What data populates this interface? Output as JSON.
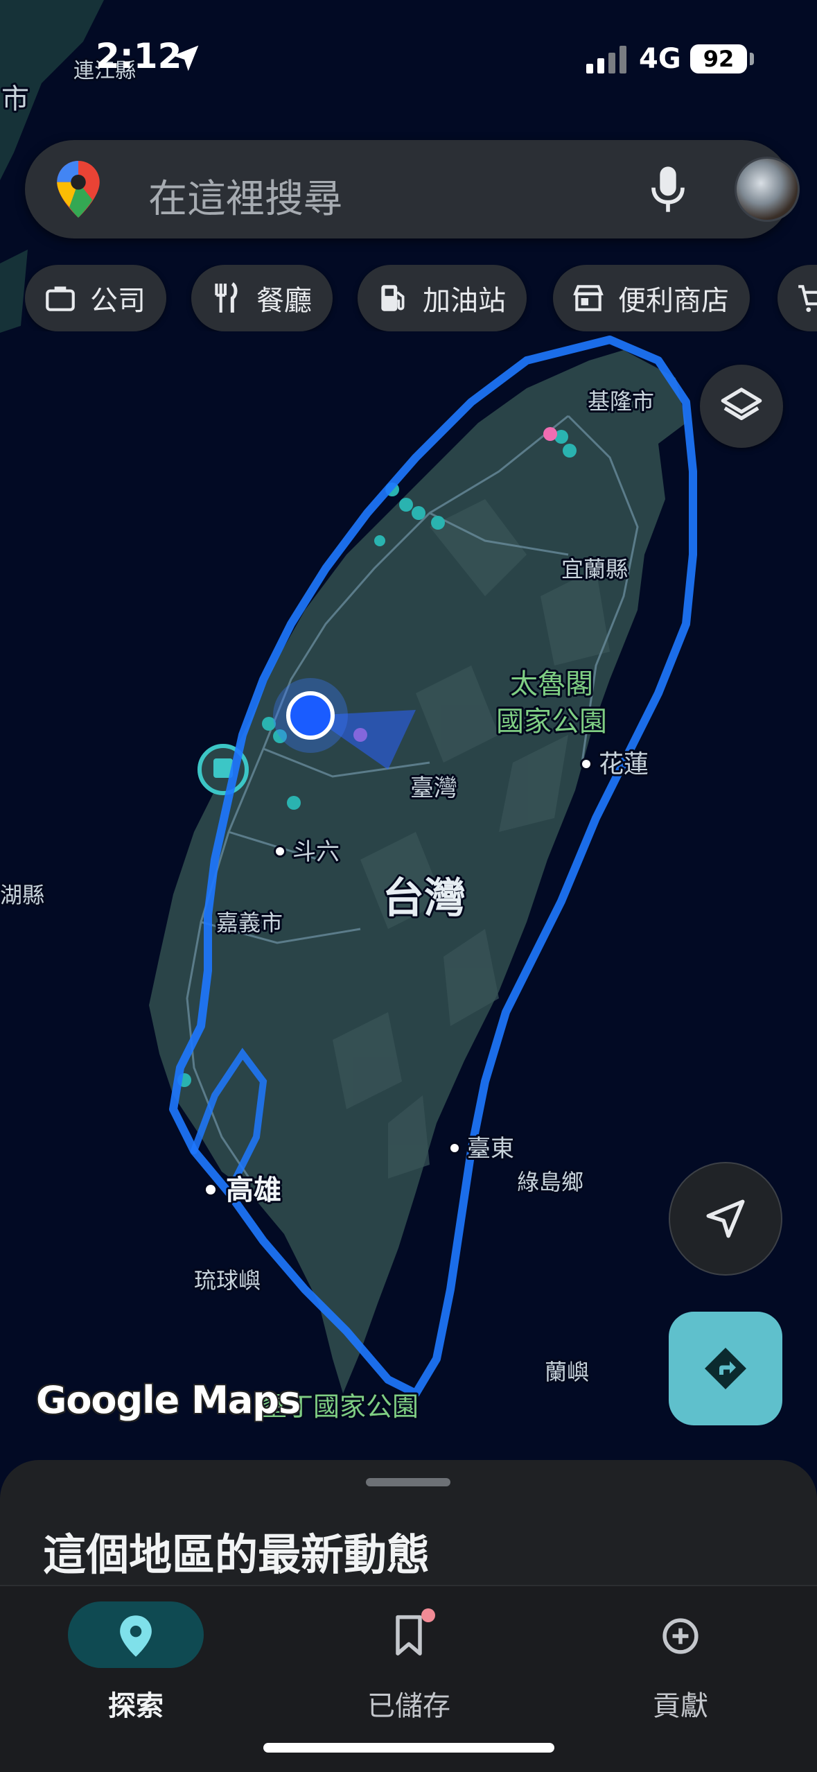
{
  "status_bar": {
    "time": "2:12",
    "network": "4G",
    "battery": "92"
  },
  "search": {
    "placeholder": "在這裡搜尋"
  },
  "chips": [
    {
      "label": "公司",
      "icon": "briefcase-icon"
    },
    {
      "label": "餐廳",
      "icon": "restaurant-icon"
    },
    {
      "label": "加油站",
      "icon": "gas-station-icon"
    },
    {
      "label": "便利商店",
      "icon": "store-icon"
    }
  ],
  "map": {
    "labels": {
      "lianjiang": "連江縣",
      "city_edge": "市",
      "keelung": "基隆市",
      "yilan": "宜蘭縣",
      "taroko_1": "太魯閣",
      "taroko_2": "國家公園",
      "hualien": "花蓮",
      "taiwan_region": "臺灣",
      "taiwan_big": "台灣",
      "douliu": "斗六",
      "chiayi": "嘉義市",
      "penghu_edge": "湖縣",
      "taitung": "臺東",
      "green_island": "綠島鄉",
      "kaohsiung": "高雄",
      "liuqiu": "琉球嶼",
      "orchid_island": "蘭嶼",
      "kenting": "墾丁國家公園"
    },
    "colors": {
      "sea": "#020a24",
      "land": "#2a4448",
      "route": "#1e78ff",
      "you": "#1a5cff",
      "park_text": "#7fce83"
    }
  },
  "branding": {
    "logo_text": "Google Maps"
  },
  "sheet": {
    "title": "這個地區的最新動態"
  },
  "nav": [
    {
      "label": "探索",
      "icon": "explore-pin-icon",
      "active": true
    },
    {
      "label": "已儲存",
      "icon": "bookmark-icon",
      "active": false,
      "badge": true
    },
    {
      "label": "貢獻",
      "icon": "add-circle-icon",
      "active": false
    }
  ]
}
